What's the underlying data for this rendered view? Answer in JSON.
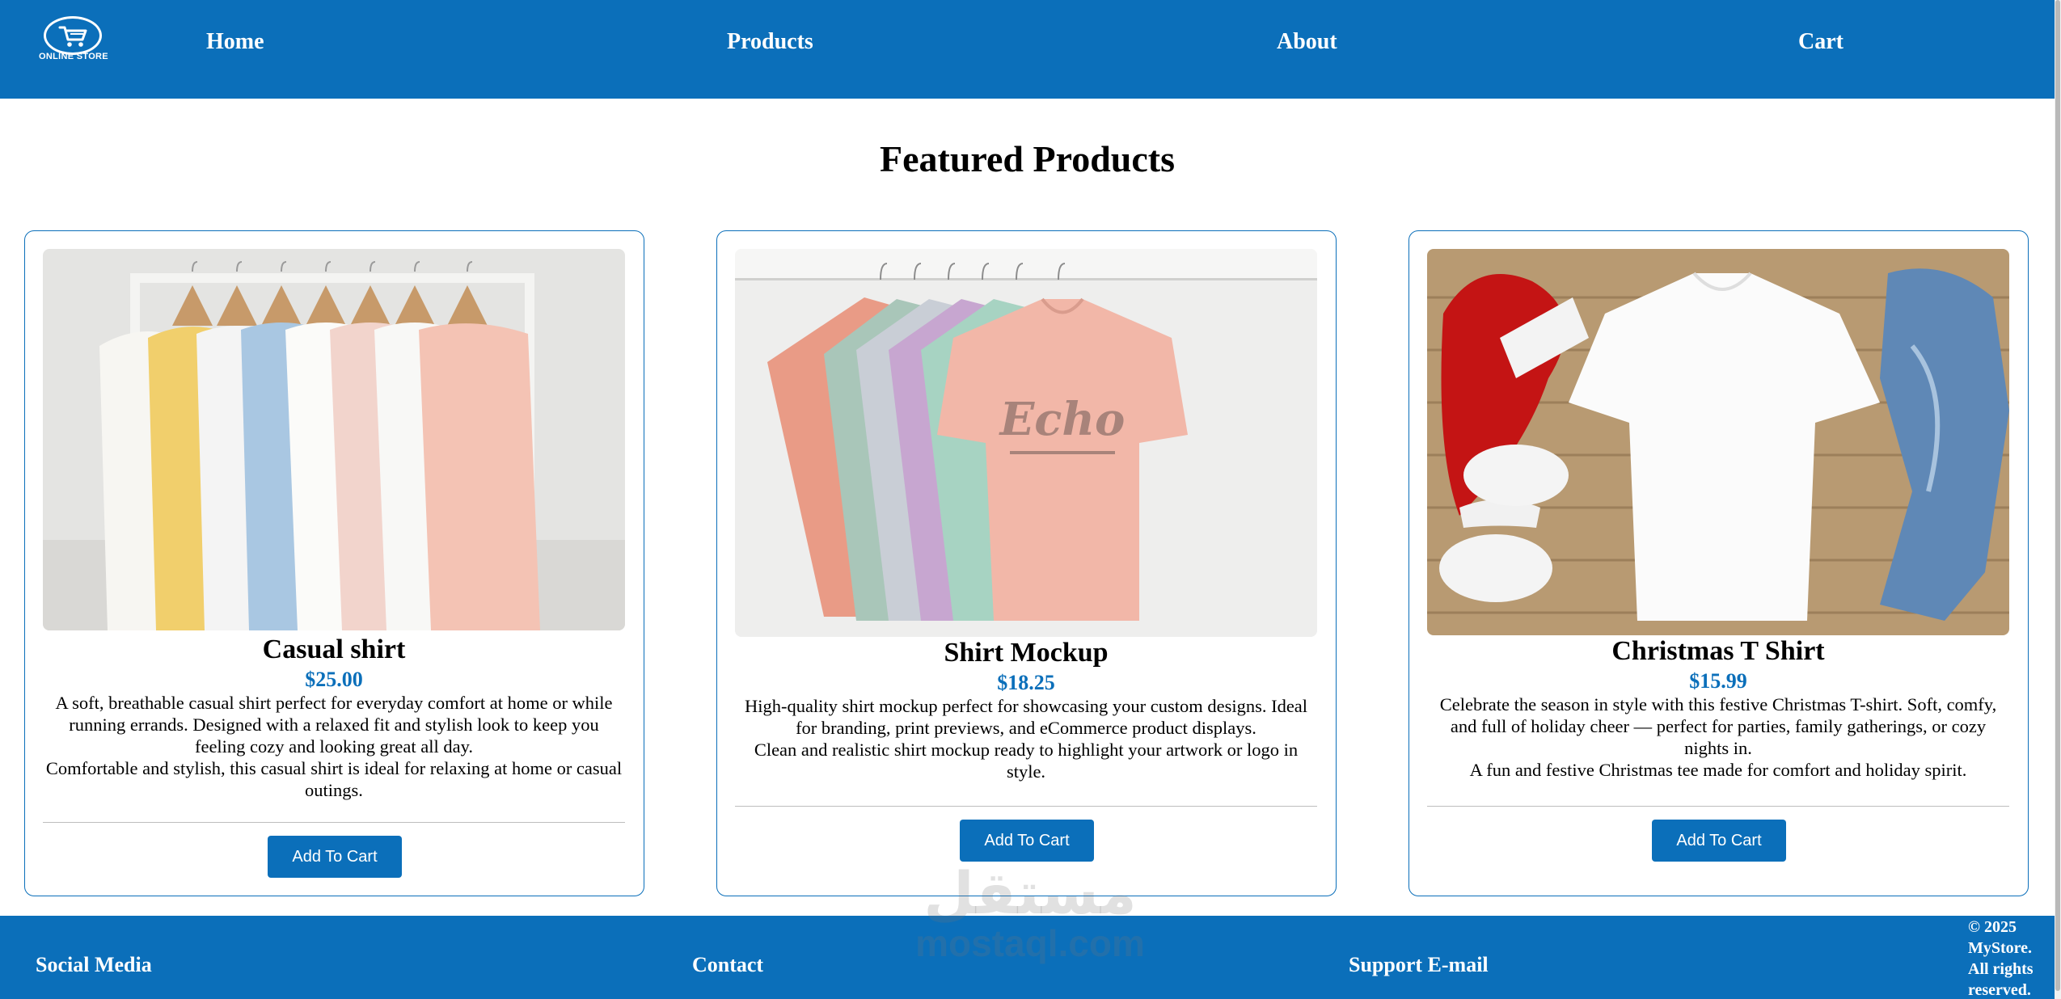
{
  "header": {
    "logo_text": "ONLINE STORE",
    "nav": [
      {
        "label": "Home"
      },
      {
        "label": "Products"
      },
      {
        "label": "About"
      },
      {
        "label": "Cart"
      }
    ]
  },
  "main": {
    "title": "Featured Products",
    "products": [
      {
        "name": "Casual shirt",
        "price": "$25.00",
        "description": [
          "A soft, breathable casual shirt perfect for everyday comfort at home or while running errands. Designed with a relaxed fit and stylish look to keep you feeling cozy and looking great all day.",
          "Comfortable and stylish, this casual shirt is ideal for relaxing at home or casual outings."
        ],
        "button_label": "Add To Cart"
      },
      {
        "name": "Shirt Mockup",
        "price": "$18.25",
        "description": [
          "High-quality shirt mockup perfect for showcasing your custom designs. Ideal for branding, print previews, and eCommerce product displays.",
          "Clean and realistic shirt mockup ready to highlight your artwork or logo in style."
        ],
        "button_label": "Add To Cart"
      },
      {
        "name": "Christmas T Shirt",
        "price": "$15.99",
        "description": [
          "Celebrate the season in style with this festive Christmas T-shirt. Soft, comfy, and full of holiday cheer — perfect for parties, family gatherings, or cozy nights in.",
          "A fun and festive Christmas tee made for comfort and holiday spirit."
        ],
        "button_label": "Add To Cart"
      }
    ]
  },
  "footer": {
    "social_label": "Social Media",
    "contact_label": "Contact",
    "support_label": "Support E-mail",
    "copyright": "© 2025 MyStore. All rights reserved."
  },
  "watermark": {
    "arabic": "مستقل",
    "latin": "mostaql.com"
  },
  "colors": {
    "brand": "#0b6fba",
    "background": "#ffffff"
  },
  "icons": {
    "logo": "shopping-cart-icon"
  }
}
